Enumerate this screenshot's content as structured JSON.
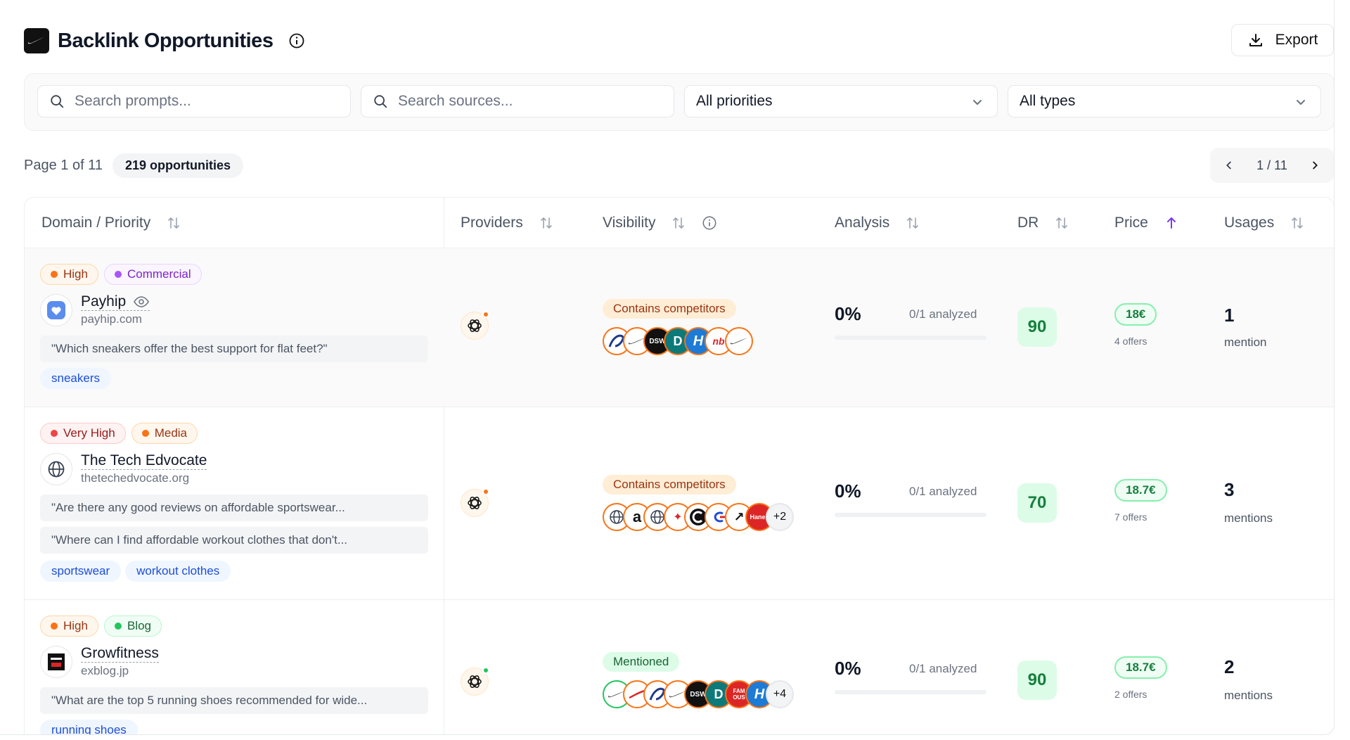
{
  "header": {
    "title": "Backlink Opportunities",
    "export_label": "Export"
  },
  "filters": {
    "search_prompts_placeholder": "Search prompts...",
    "search_sources_placeholder": "Search sources...",
    "priority_value": "All priorities",
    "type_value": "All types"
  },
  "pagination": {
    "page_text": "Page 1 of 11",
    "count_text": "219 opportunities",
    "pager_text": "1 / 11"
  },
  "columns": {
    "domain": "Domain / Priority",
    "providers": "Providers",
    "visibility": "Visibility",
    "analysis": "Analysis",
    "dr": "DR",
    "price": "Price",
    "usages": "Usages"
  },
  "rows": [
    {
      "priority": "High",
      "type": "Commercial",
      "name": "Payhip",
      "domain": "payhip.com",
      "prompts": [
        "\"Which sneakers offer the best support for flat feet?\""
      ],
      "tags": [
        "sneakers"
      ],
      "visibility_label": "Contains competitors",
      "avatars": [
        "asics",
        "nike",
        "DSW",
        "D",
        "H",
        "new-balance",
        "nike"
      ],
      "avatars_more": "",
      "analysis_pct": "0%",
      "analyzed": "0/1 analyzed",
      "dr": "90",
      "price": "18€",
      "offers": "4 offers",
      "usages": "1",
      "usages_label": "mention"
    },
    {
      "priority": "Very High",
      "type": "Media",
      "name": "The Tech Edvocate",
      "domain": "thetechedvocate.org",
      "prompts": [
        "\"Are there any good reviews on affordable sportswear...",
        "\"Where can I find affordable workout clothes that don't..."
      ],
      "tags": [
        "sportswear",
        "workout clothes"
      ],
      "visibility_label": "Contains competitors",
      "avatars": [
        "globe",
        "a",
        "globe",
        "jumpman",
        "c",
        "champion",
        "arrow",
        "hanes"
      ],
      "avatars_more": "+2",
      "analysis_pct": "0%",
      "analyzed": "0/1 analyzed",
      "dr": "70",
      "price": "18.7€",
      "offers": "7 offers",
      "usages": "3",
      "usages_label": "mentions"
    },
    {
      "priority": "High",
      "type": "Blog",
      "name": "Growfitness",
      "domain": "exblog.jp",
      "prompts": [
        "\"What are the top 5 running shoes recommended for wide..."
      ],
      "tags": [
        "running shoes"
      ],
      "visibility_label": "Mentioned",
      "avatars": [
        "nike",
        "puma",
        "asics",
        "nike",
        "DSW",
        "D",
        "FAMOUS",
        "H"
      ],
      "avatars_more": "+4",
      "analysis_pct": "0%",
      "analyzed": "0/1 analyzed",
      "dr": "90",
      "price": "18.7€",
      "offers": "2 offers",
      "usages": "2",
      "usages_label": "mentions"
    }
  ],
  "colors": {
    "high": "#f97316",
    "very_high": "#ef4444",
    "commercial": "#a855f7",
    "blog": "#22c55e",
    "dr_bg": "#dcfce7",
    "sort_active": "#7c3aed"
  }
}
